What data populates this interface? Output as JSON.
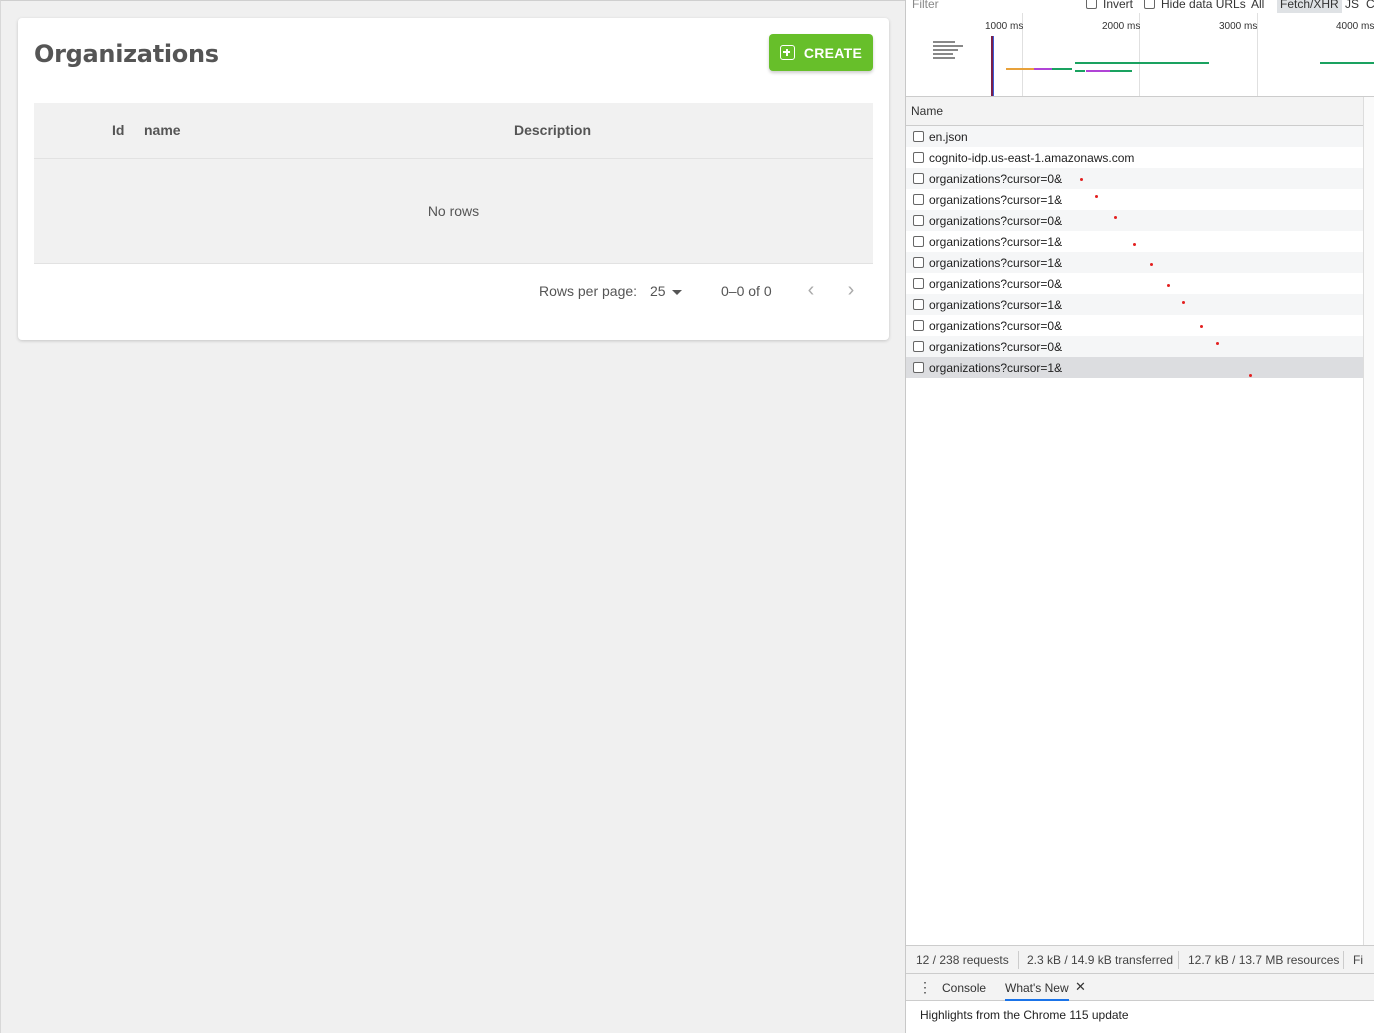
{
  "app": {
    "page_title": "Organizations",
    "create_label": "CREATE",
    "columns": {
      "id": "Id",
      "name": "name",
      "description": "Description"
    },
    "empty_text": "No rows",
    "pager": {
      "rows_per_page_label": "Rows per page:",
      "rows_per_page_value": "25",
      "range": "0–0 of 0"
    },
    "accent_color": "#67bf2a"
  },
  "devtools": {
    "filter_placeholder": "Filter",
    "invert_label": "Invert",
    "hide_data_urls_label": "Hide data URLs",
    "type_all": "All",
    "type_fetch": "Fetch/XHR",
    "type_js": "JS",
    "type_c": "C",
    "timeline_labels": [
      "1000 ms",
      "2000 ms",
      "3000 ms",
      "4000 ms"
    ],
    "column_name": "Name",
    "requests": [
      "en.json",
      "cognito-idp.us-east-1.amazonaws.com",
      "organizations?cursor=0&",
      "organizations?cursor=1&",
      "organizations?cursor=0&",
      "organizations?cursor=1&",
      "organizations?cursor=1&",
      "organizations?cursor=0&",
      "organizations?cursor=1&",
      "organizations?cursor=0&",
      "organizations?cursor=0&",
      "organizations?cursor=1&"
    ],
    "status": {
      "requests": "12 / 238 requests",
      "transferred": "2.3 kB / 14.9 kB transferred",
      "resources": "12.7 kB / 13.7 MB resources",
      "finish": "Fi"
    },
    "drawer": {
      "console_tab": "Console",
      "whats_new_tab": "What's New",
      "highlights": "Highlights from the Chrome 115 update"
    }
  }
}
